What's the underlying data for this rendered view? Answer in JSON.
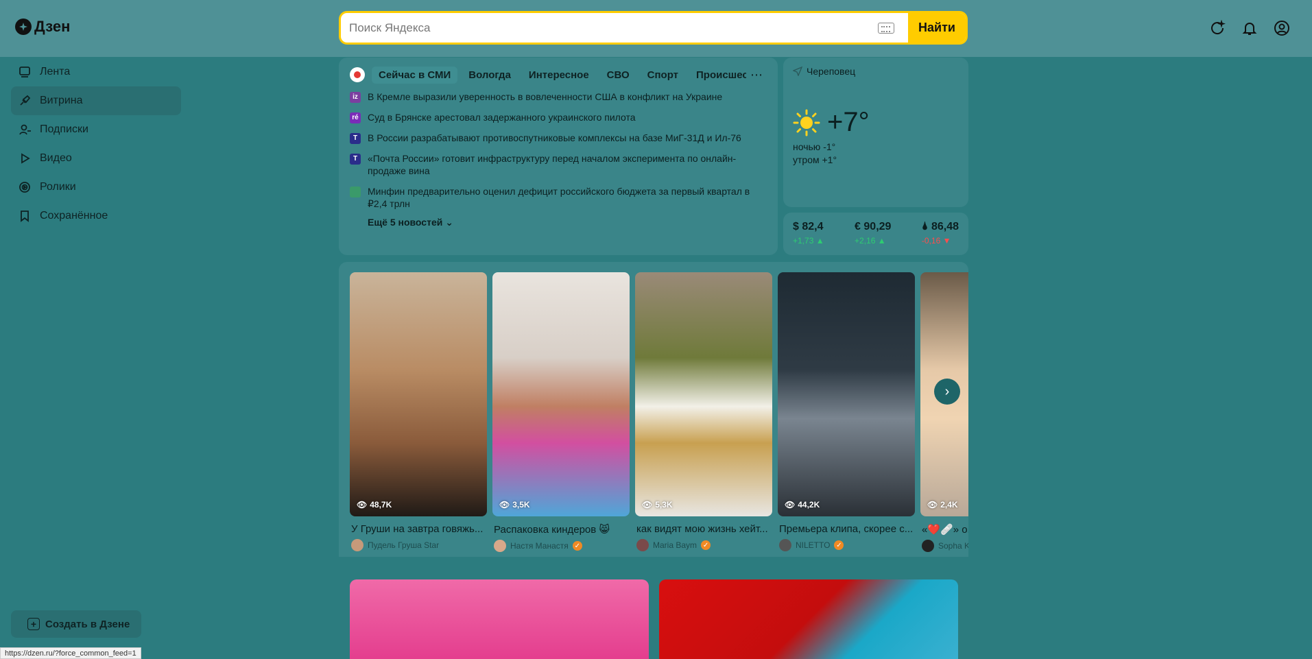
{
  "header": {
    "logo_text": "Дзен",
    "search_placeholder": "Поиск Яндекса",
    "search_button": "Найти"
  },
  "sidebar": {
    "items": [
      {
        "label": "Лента",
        "icon": "feed-icon"
      },
      {
        "label": "Витрина",
        "icon": "showcase-icon",
        "active": true
      },
      {
        "label": "Подписки",
        "icon": "subscriptions-icon"
      },
      {
        "label": "Видео",
        "icon": "play-icon"
      },
      {
        "label": "Ролики",
        "icon": "shorts-icon"
      },
      {
        "label": "Сохранённое",
        "icon": "bookmark-icon"
      }
    ],
    "create_button": "Создать в Дзене"
  },
  "news": {
    "tabs": [
      "Сейчас в СМИ",
      "Вологда",
      "Интересное",
      "СВО",
      "Спорт",
      "Происшествия"
    ],
    "items": [
      {
        "text": "В Кремле выразили уверенность в вовлеченности США в конфликт на Украине",
        "src_color": "#7b3fa0",
        "src_letter": "iz"
      },
      {
        "text": "Суд в Брянске арестовал задержанного украинского пилота",
        "src_color": "#7a2cb8",
        "src_letter": "ré"
      },
      {
        "text": "В России разрабатывают противоспутниковые комплексы на базе МиГ-31Д и Ил-76",
        "src_color": "#2a2d8a",
        "src_letter": "T"
      },
      {
        "text": "«Почта России» готовит инфраструктуру перед началом эксперимента по онлайн-продаже вина",
        "src_color": "#2a2d8a",
        "src_letter": "T"
      },
      {
        "text": "Минфин предварительно оценил дефицит российского бюджета за первый квартал в ₽2,4 трлн",
        "src_color": "#3a9a6a",
        "src_letter": ""
      }
    ],
    "more": "Ещё 5 новостей"
  },
  "weather": {
    "city": "Череповец",
    "temp": "+7°",
    "night": "ночью -1°",
    "morning": "утром +1°"
  },
  "rates": [
    {
      "value": "$ 82,4",
      "change": "+1,73 ▲",
      "dir": "up"
    },
    {
      "value": "€ 90,29",
      "change": "+2,16 ▲",
      "dir": "up"
    },
    {
      "value": "🌢 86,48",
      "change": "-0,16 ▼",
      "dir": "down"
    }
  ],
  "videos": [
    {
      "views": "48,7K",
      "title": "У Груши на завтра говяжь...",
      "author": "Пудель Груша Star",
      "verified": false,
      "bg": "linear-gradient(180deg,#c9b49a 0%,#b98c64 40%,#8a5b3b 70%,#201a16 100%)",
      "ava": "#c69a7a"
    },
    {
      "views": "3,5K",
      "title": "Распаковка киндеров 😸",
      "author": "Настя Манастя",
      "verified": true,
      "bg": "linear-gradient(180deg,#e9e4de 0%,#d8cfc7 35%,#c07f63 55%,#d24fa0 70%,#4fa6d8 100%)",
      "ava": "#d9a88a"
    },
    {
      "views": "5,3K",
      "title": "как видят мою жизнь хейт...",
      "author": "Maria Baym",
      "verified": true,
      "bg": "linear-gradient(180deg,#9a8a78 0%,#6f7a3a 35%,#f2f0e8 55%,#c8a050 70%,#e8e6e2 100%)",
      "ava": "#7a4a4a"
    },
    {
      "views": "44,2K",
      "title": "Премьера клипа, скорее с...",
      "author": "NILETTO",
      "verified": true,
      "bg": "linear-gradient(180deg,#1e2a33 0%,#2f3b45 40%,#7a8590 60%,#2a3036 100%)",
      "ava": "#555"
    },
    {
      "views": "2,4K",
      "title": "«❤️🩹» о...",
      "author": "Sopha K",
      "verified": false,
      "bg": "linear-gradient(180deg,#6a5a48 0%,#e6c9a8 40%,#f0d4b2 60%,#b8a898 100%)",
      "ava": "#222"
    }
  ],
  "bottom_cards": [
    {
      "bg": "linear-gradient(180deg,#f06aa8 0%,#e43e8e 100%)"
    },
    {
      "bg": "linear-gradient(135deg,#d80f0f 0%,#c40d0d 50%,#1aa8c8 70%,#3ab0d0 100%)"
    }
  ],
  "status_url": "https://dzen.ru/?force_common_feed=1"
}
